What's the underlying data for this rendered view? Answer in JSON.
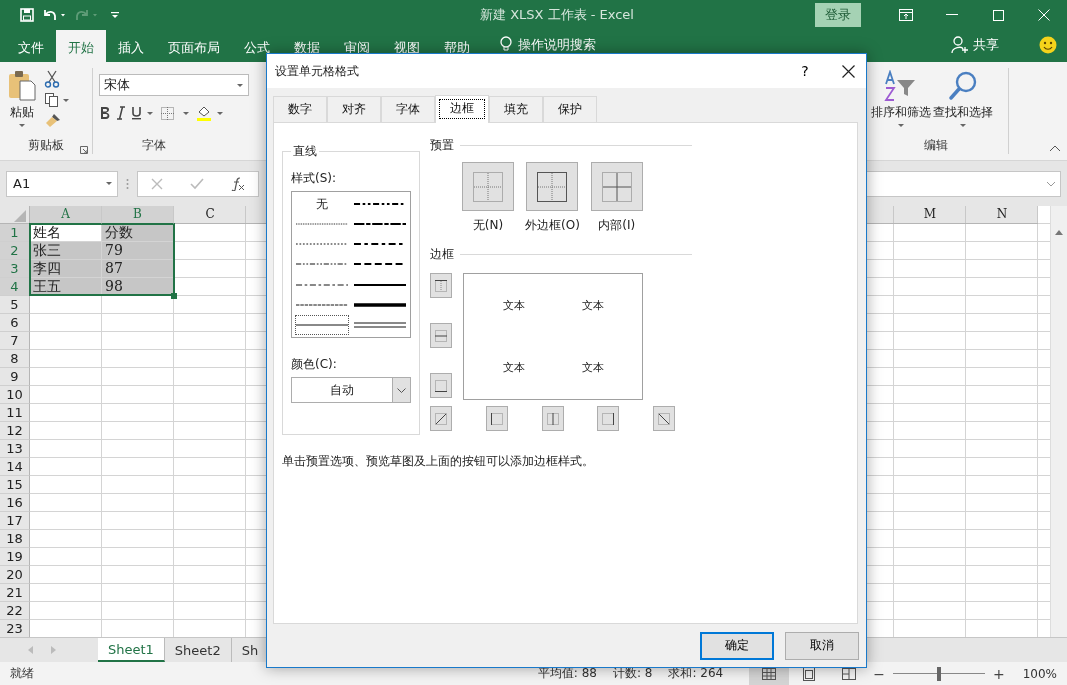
{
  "title_bar": {
    "title": "新建 XLSX 工作表  -  Excel",
    "login": "登录"
  },
  "ribbon_tabs": [
    {
      "label": "文件",
      "selected": false
    },
    {
      "label": "开始",
      "selected": true
    },
    {
      "label": "插入",
      "selected": false
    },
    {
      "label": "页面布局",
      "selected": false
    },
    {
      "label": "公式",
      "selected": false
    },
    {
      "label": "数据",
      "selected": false
    },
    {
      "label": "审阅",
      "selected": false
    },
    {
      "label": "视图",
      "selected": false
    },
    {
      "label": "帮助",
      "selected": false
    }
  ],
  "tell_me": "操作说明搜索",
  "share": "共享",
  "clipboard_group": {
    "paste": "粘贴",
    "label": "剪贴板"
  },
  "font_group": {
    "font_name": "宋体",
    "label": "字体"
  },
  "editing_group": {
    "sort_filter": "排序和筛选",
    "find_select": "查找和选择",
    "label": "编辑"
  },
  "name_box": "A1",
  "sheet": {
    "columns": [
      {
        "label": "A",
        "selected": true
      },
      {
        "label": "B",
        "selected": true
      },
      {
        "label": "C",
        "selected": false
      }
    ],
    "right_columns": [
      {
        "label": "M",
        "selected": false
      },
      {
        "label": "N",
        "selected": false
      }
    ],
    "row_numbers": [
      {
        "label": "1",
        "selected": true
      },
      {
        "label": "2",
        "selected": true
      },
      {
        "label": "3",
        "selected": true
      },
      {
        "label": "4",
        "selected": true
      },
      {
        "label": "5",
        "selected": false
      },
      {
        "label": "6",
        "selected": false
      },
      {
        "label": "7",
        "selected": false
      },
      {
        "label": "8",
        "selected": false
      },
      {
        "label": "9",
        "selected": false
      },
      {
        "label": "10",
        "selected": false
      },
      {
        "label": "11",
        "selected": false
      },
      {
        "label": "12",
        "selected": false
      },
      {
        "label": "13",
        "selected": false
      },
      {
        "label": "14",
        "selected": false
      },
      {
        "label": "15",
        "selected": false
      },
      {
        "label": "16",
        "selected": false
      },
      {
        "label": "17",
        "selected": false
      },
      {
        "label": "18",
        "selected": false
      },
      {
        "label": "19",
        "selected": false
      },
      {
        "label": "20",
        "selected": false
      },
      {
        "label": "21",
        "selected": false
      },
      {
        "label": "22",
        "selected": false
      },
      {
        "label": "23",
        "selected": false
      }
    ],
    "rows": [
      {
        "cells": [
          {
            "text": "姓名",
            "highlighted": false
          },
          {
            "text": "分数",
            "highlighted": true
          }
        ]
      },
      {
        "cells": [
          {
            "text": "张三",
            "highlighted": true
          },
          {
            "text": "79",
            "highlighted": true
          }
        ]
      },
      {
        "cells": [
          {
            "text": "李四",
            "highlighted": true
          },
          {
            "text": "87",
            "highlighted": true
          }
        ]
      },
      {
        "cells": [
          {
            "text": "王五",
            "highlighted": true
          },
          {
            "text": "98",
            "highlighted": true
          }
        ]
      }
    ]
  },
  "sheet_tabs": [
    {
      "label": "Sheet1",
      "selected": true
    },
    {
      "label": "Sheet2",
      "selected": false
    },
    {
      "label": "Sh",
      "selected": false
    }
  ],
  "status_bar": {
    "status": "就绪",
    "stats": [
      "平均值: 88",
      "计数: 8",
      "求和: 264"
    ],
    "views": [
      {
        "kind": "normal",
        "selected": true
      },
      {
        "kind": "page-layout",
        "selected": false
      },
      {
        "kind": "page-break",
        "selected": false
      }
    ],
    "zoom_minus": "−",
    "zoom_plus": "+",
    "zoom": {
      "level": 0.5
    },
    "zoom_percent": "100%"
  },
  "dialog": {
    "title": "设置单元格格式",
    "help": "?",
    "tabs": [
      {
        "label": "数字",
        "selected": false
      },
      {
        "label": "对齐",
        "selected": false
      },
      {
        "label": "字体",
        "selected": false
      },
      {
        "label": "边框",
        "selected": true
      },
      {
        "label": "填充",
        "selected": false
      },
      {
        "label": "保护",
        "selected": false
      }
    ],
    "line_group": {
      "title": "直线",
      "style_label": "样式(S):",
      "styles": [
        {
          "kind": "none",
          "label": "无",
          "selected": false
        },
        {
          "kind": "hair",
          "selected": false
        },
        {
          "kind": "dotted",
          "selected": false
        },
        {
          "kind": "dash-dot-dot",
          "selected": false
        },
        {
          "kind": "dash-dot",
          "selected": false
        },
        {
          "kind": "dashed",
          "selected": false
        },
        {
          "kind": "thin",
          "selected": true
        },
        {
          "kind": "medium-dash-dot-dot",
          "selected": false
        },
        {
          "kind": "slant-dash-dot",
          "selected": false
        },
        {
          "kind": "medium-dash-dot",
          "selected": false
        },
        {
          "kind": "medium-dashed",
          "selected": false
        },
        {
          "kind": "medium",
          "selected": false
        },
        {
          "kind": "thick",
          "selected": false
        },
        {
          "kind": "double",
          "selected": false
        }
      ],
      "color_label": "颜色(C):",
      "color_value": "自动"
    },
    "presets_title": "预置",
    "presets": [
      {
        "kind": "none",
        "label": "无(N)"
      },
      {
        "kind": "outline",
        "label": "外边框(O)"
      },
      {
        "kind": "inside",
        "label": "内部(I)"
      }
    ],
    "border_title": "边框",
    "preview_texts": [
      "文本",
      "文本",
      "文本",
      "文本"
    ],
    "border_buttons_left": [
      {
        "kind": "top"
      },
      {
        "kind": "middle-h"
      },
      {
        "kind": "bottom"
      }
    ],
    "border_buttons_bottom": [
      {
        "kind": "diag-up"
      },
      {
        "kind": "left"
      },
      {
        "kind": "middle-v"
      },
      {
        "kind": "right"
      },
      {
        "kind": "diag-down"
      }
    ],
    "hint": "单击预置选项、预览草图及上面的按钮可以添加边框样式。",
    "ok": "确定",
    "cancel": "取消"
  }
}
